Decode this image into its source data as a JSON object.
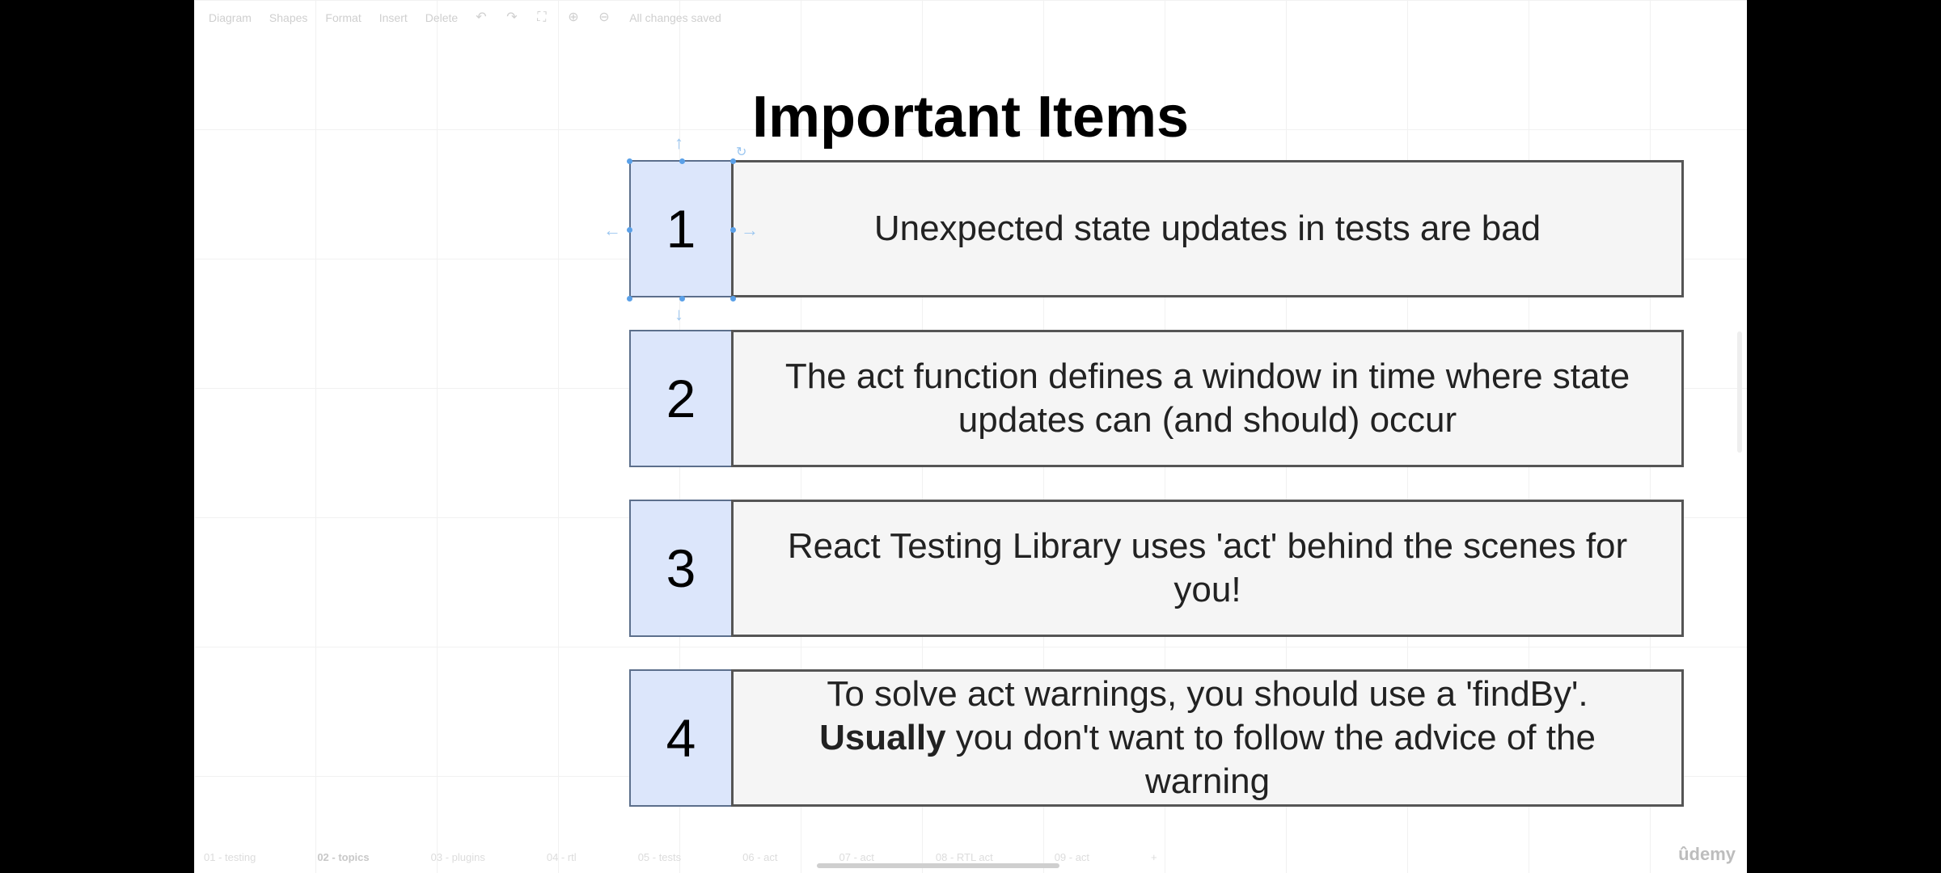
{
  "toolbar": {
    "diagram": "Diagram",
    "shapes": "Shapes",
    "format": "Format",
    "insert": "Insert",
    "delete": "Delete",
    "status": "All changes saved"
  },
  "title": "Important Items",
  "items": [
    {
      "number": "1",
      "text": "Unexpected state updates in tests are bad"
    },
    {
      "number": "2",
      "text": "The act function defines a window in time where state updates can (and should) occur"
    },
    {
      "number": "3",
      "text": "React Testing Library uses 'act' behind the scenes for you!"
    },
    {
      "number": "4",
      "line1": "To solve act warnings, you should use a 'findBy'.",
      "bold": "Usually",
      "rest": " you don't want to follow the advice of the warning"
    }
  ],
  "tabs": [
    "01 - testing",
    "02 - topics",
    "03 - plugins",
    "04 - rtl",
    "05 - tests",
    "06 - act",
    "07 - act",
    "08 - RTL act",
    "09 - act"
  ],
  "watermark": "ûdemy"
}
